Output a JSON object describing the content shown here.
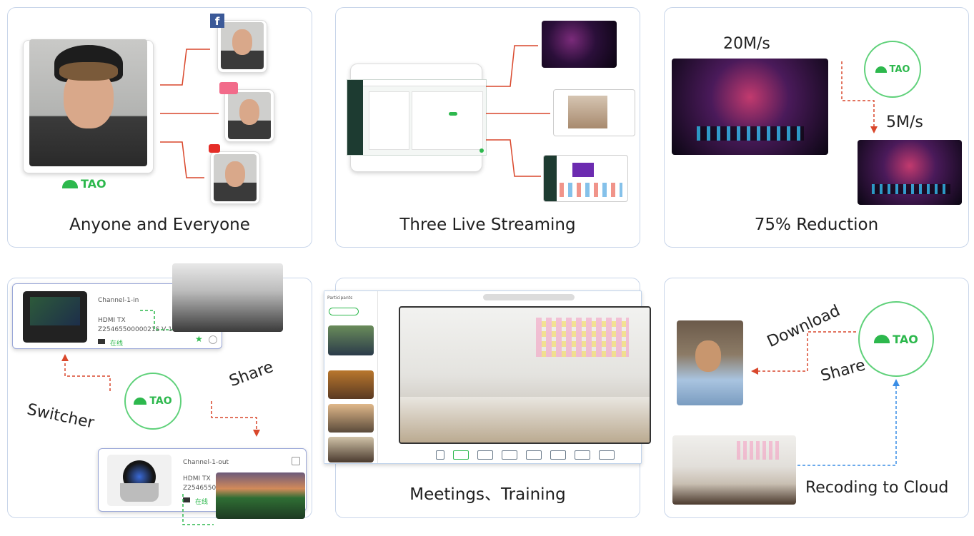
{
  "brand": {
    "name": "TAO",
    "color": "#2db84d"
  },
  "arrow_colors": {
    "red": "#d9472b",
    "green": "#2db84d",
    "blue": "#3a8ee6"
  },
  "cards": [
    {
      "caption": "Anyone and Everyone"
    },
    {
      "caption": "Three Live Streaming"
    },
    {
      "caption": "75% Reduction",
      "rate_before": "20M/s",
      "rate_after": "5M/s"
    },
    {
      "caption": "",
      "label_share": "Share",
      "label_switcher": "Switcher",
      "device_in": {
        "title": "Channel-1-in",
        "type": "HDMI TX",
        "serial": "Z2546550000021S V 1",
        "status": "在线"
      },
      "device_out": {
        "title": "Channel-1-out",
        "type": "HDMI TX",
        "serial": "Z2546550000",
        "status": "在线"
      }
    },
    {
      "caption": "Meetings、Training",
      "sidebar_title": "Participants"
    },
    {
      "caption": "Recoding to Cloud",
      "label_download": "Download",
      "label_share": "Share"
    }
  ],
  "social_icons": [
    "facebook-icon",
    "lalala-icon",
    "youtube-icon"
  ]
}
